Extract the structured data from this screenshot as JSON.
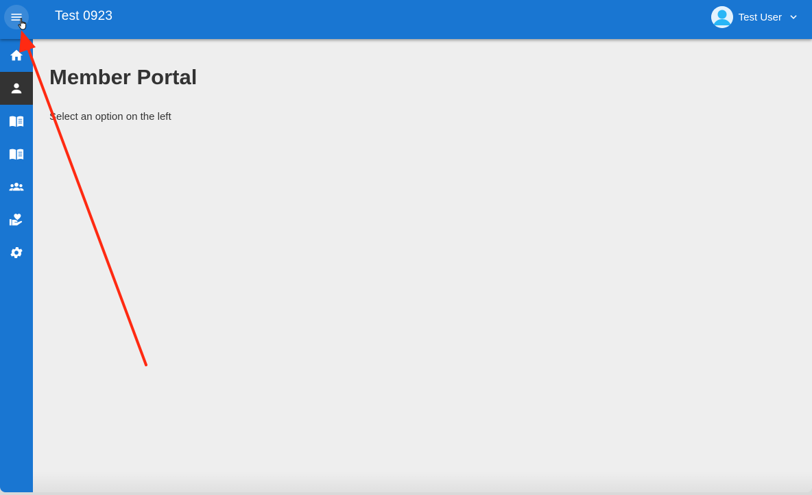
{
  "header": {
    "app_title": "Test 0923",
    "menu_icon": "hamburger-menu-icon",
    "user": {
      "name": "Test User",
      "avatar_icon": "account-circle-icon",
      "dropdown_icon": "chevron-down-icon"
    }
  },
  "sidebar": {
    "items": [
      {
        "icon": "home-icon",
        "active": false
      },
      {
        "icon": "person-icon",
        "active": true
      },
      {
        "icon": "open-book-icon",
        "active": false
      },
      {
        "icon": "open-book-icon",
        "active": false
      },
      {
        "icon": "group-icon",
        "active": false
      },
      {
        "icon": "volunteer-hand-heart-icon",
        "active": false
      },
      {
        "icon": "gear-icon",
        "active": false
      }
    ]
  },
  "main": {
    "title": "Member Portal",
    "hint": "Select an option on the left"
  },
  "colors": {
    "primary": "#1976d2",
    "active_nav": "#333333",
    "background": "#eeeeee",
    "annotation_arrow": "#ff2a12"
  }
}
